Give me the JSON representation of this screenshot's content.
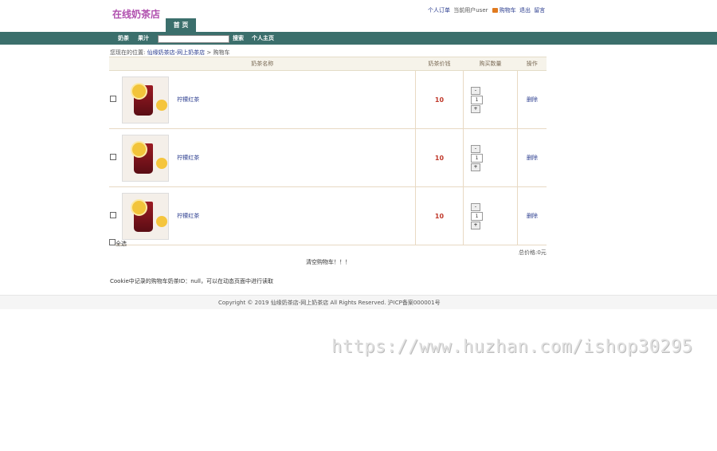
{
  "header": {
    "logo": "在线奶茶店",
    "links": {
      "orders": "个人订单",
      "current_user": "当前用户user",
      "cart": "购物车",
      "logout": "退出",
      "message": "留言"
    },
    "home_tab": "首 页"
  },
  "nav": {
    "items": [
      "奶茶",
      "果汁"
    ],
    "search_button": "搜索",
    "personal_home": "个人主页",
    "search_value": ""
  },
  "breadcrumb": {
    "prefix": "您现在的位置:",
    "site": "仙缘奶茶店-网上奶茶店",
    "separator": ">",
    "current": "购物车"
  },
  "cart": {
    "headers": [
      "奶茶名称",
      "奶茶价钱",
      "购买数量",
      "操作"
    ],
    "rows": [
      {
        "name": "柠檬红茶",
        "price": "10",
        "qty": "1",
        "minus": "-",
        "plus": "+",
        "delete": "删除"
      },
      {
        "name": "柠檬红茶",
        "price": "10",
        "qty": "1",
        "minus": "-",
        "plus": "+",
        "delete": "删除"
      },
      {
        "name": "柠檬红茶",
        "price": "10",
        "qty": "1",
        "minus": "-",
        "plus": "+",
        "delete": "删除"
      }
    ],
    "select_all": "全选",
    "total": "总价格:0元",
    "clear": "清空购物车！！！",
    "cookie_note": "Cookie中记录的购物车奶茶ID：null，可以在动态页面中进行读取"
  },
  "footer": {
    "copyright": "Copyright © 2019 仙缘奶茶店-网上奶茶店 All Rights Reserved. 沪ICP备案000001号"
  },
  "watermark": "https://www.huzhan.com/ishop30295",
  "colors": {
    "nav": "#3b6f6c",
    "logo": "#b04fae",
    "price": "#c0392b",
    "link": "#2b3d8f"
  }
}
